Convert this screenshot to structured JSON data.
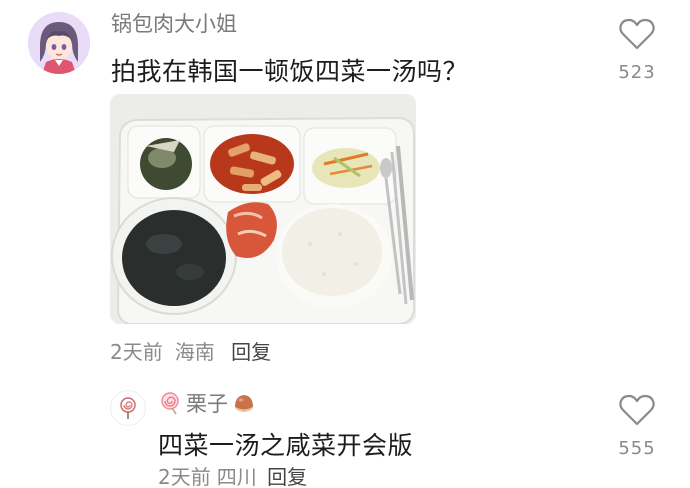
{
  "comment": {
    "username": "锅包肉大小姐",
    "text": "拍我在韩国一顿饭四菜一汤吗？",
    "time": "2天前",
    "location": "海南",
    "reply_label": "回复",
    "like_count": "523",
    "image_alt": "meal-tray-photo"
  },
  "reply": {
    "username": "栗子",
    "text": "四菜一汤之咸菜开会版",
    "time": "2天前",
    "location": "四川",
    "reply_label": "回复",
    "like_count": "555"
  }
}
